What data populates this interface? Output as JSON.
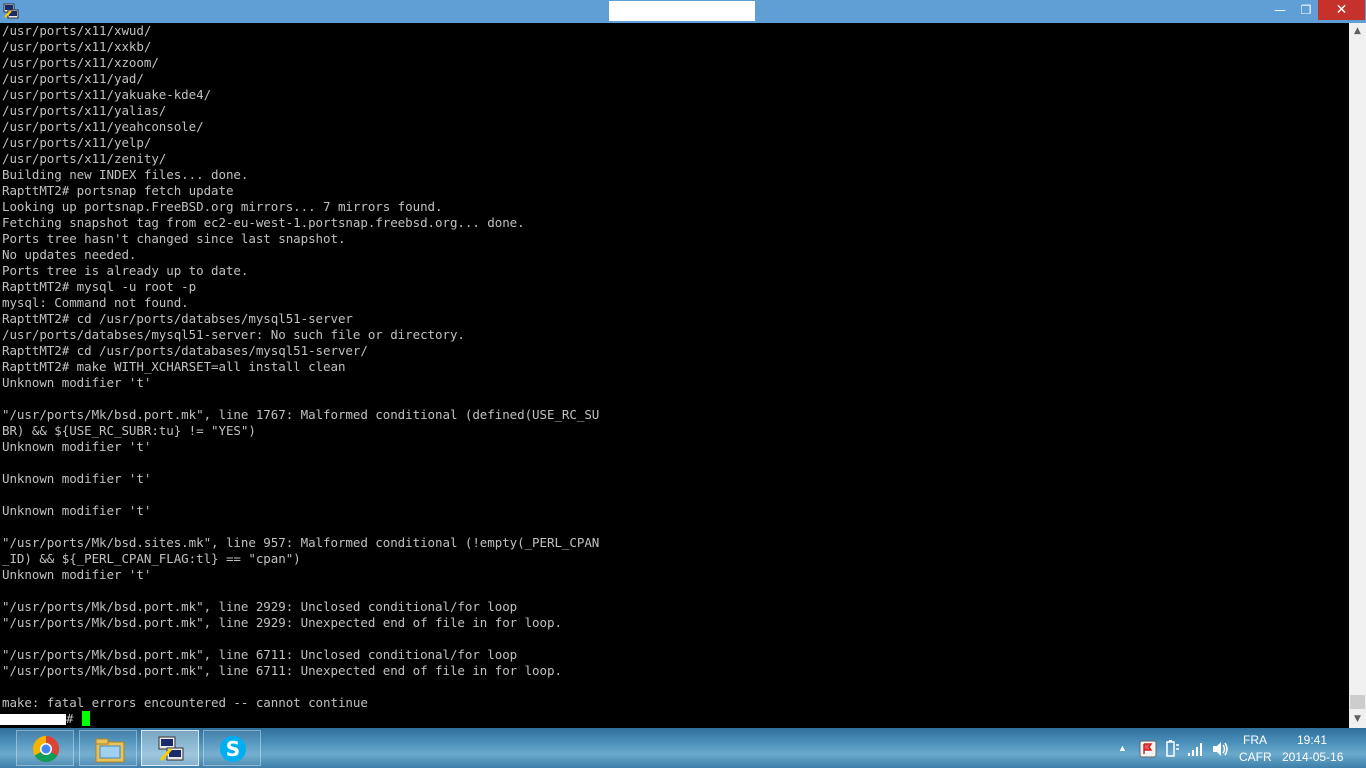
{
  "window": {
    "minimize_label": "—",
    "maximize_label": "❐",
    "close_label": "✕"
  },
  "terminal": {
    "lines": [
      "/usr/ports/x11/xwud/",
      "/usr/ports/x11/xxkb/",
      "/usr/ports/x11/xzoom/",
      "/usr/ports/x11/yad/",
      "/usr/ports/x11/yakuake-kde4/",
      "/usr/ports/x11/yalias/",
      "/usr/ports/x11/yeahconsole/",
      "/usr/ports/x11/yelp/",
      "/usr/ports/x11/zenity/",
      "Building new INDEX files... done.",
      "RapttMT2# portsnap fetch update",
      "Looking up portsnap.FreeBSD.org mirrors... 7 mirrors found.",
      "Fetching snapshot tag from ec2-eu-west-1.portsnap.freebsd.org... done.",
      "Ports tree hasn't changed since last snapshot.",
      "No updates needed.",
      "Ports tree is already up to date.",
      "RapttMT2# mysql -u root -p",
      "mysql: Command not found.",
      "RapttMT2# cd /usr/ports/databses/mysql51-server",
      "/usr/ports/databses/mysql51-server: No such file or directory.",
      "RapttMT2# cd /usr/ports/databases/mysql51-server/",
      "RapttMT2# make WITH_XCHARSET=all install clean",
      "Unknown modifier 't'",
      "",
      "\"/usr/ports/Mk/bsd.port.mk\", line 1767: Malformed conditional (defined(USE_RC_SU",
      "BR) && ${USE_RC_SUBR:tu} != \"YES\")",
      "Unknown modifier 't'",
      "",
      "Unknown modifier 't'",
      "",
      "Unknown modifier 't'",
      "",
      "\"/usr/ports/Mk/bsd.sites.mk\", line 957: Malformed conditional (!empty(_PERL_CPAN",
      "_ID) && ${_PERL_CPAN_FLAG:tl} == \"cpan\")",
      "Unknown modifier 't'",
      "",
      "\"/usr/ports/Mk/bsd.port.mk\", line 2929: Unclosed conditional/for loop",
      "\"/usr/ports/Mk/bsd.port.mk\", line 2929: Unexpected end of file in for loop.",
      "",
      "\"/usr/ports/Mk/bsd.port.mk\", line 6711: Unclosed conditional/for loop",
      "\"/usr/ports/Mk/bsd.port.mk\", line 6711: Unexpected end of file in for loop.",
      "",
      "make: fatal errors encountered -- cannot continue"
    ],
    "prompt_suffix": "#",
    "text_color": "#c0c0c0",
    "cursor_color": "#00ff00"
  },
  "scrollbar": {
    "up_icon": "▲",
    "down_icon": "▼"
  },
  "taskbar": {
    "apps": [
      {
        "name": "chrome-icon"
      },
      {
        "name": "file-explorer-icon"
      },
      {
        "name": "putty-icon",
        "active": true
      },
      {
        "name": "skype-icon"
      }
    ]
  },
  "tray": {
    "chevron": "▲",
    "language_top": "FRA",
    "language_bottom": "CAFR",
    "time": "19:41",
    "date": "2014-05-16"
  }
}
